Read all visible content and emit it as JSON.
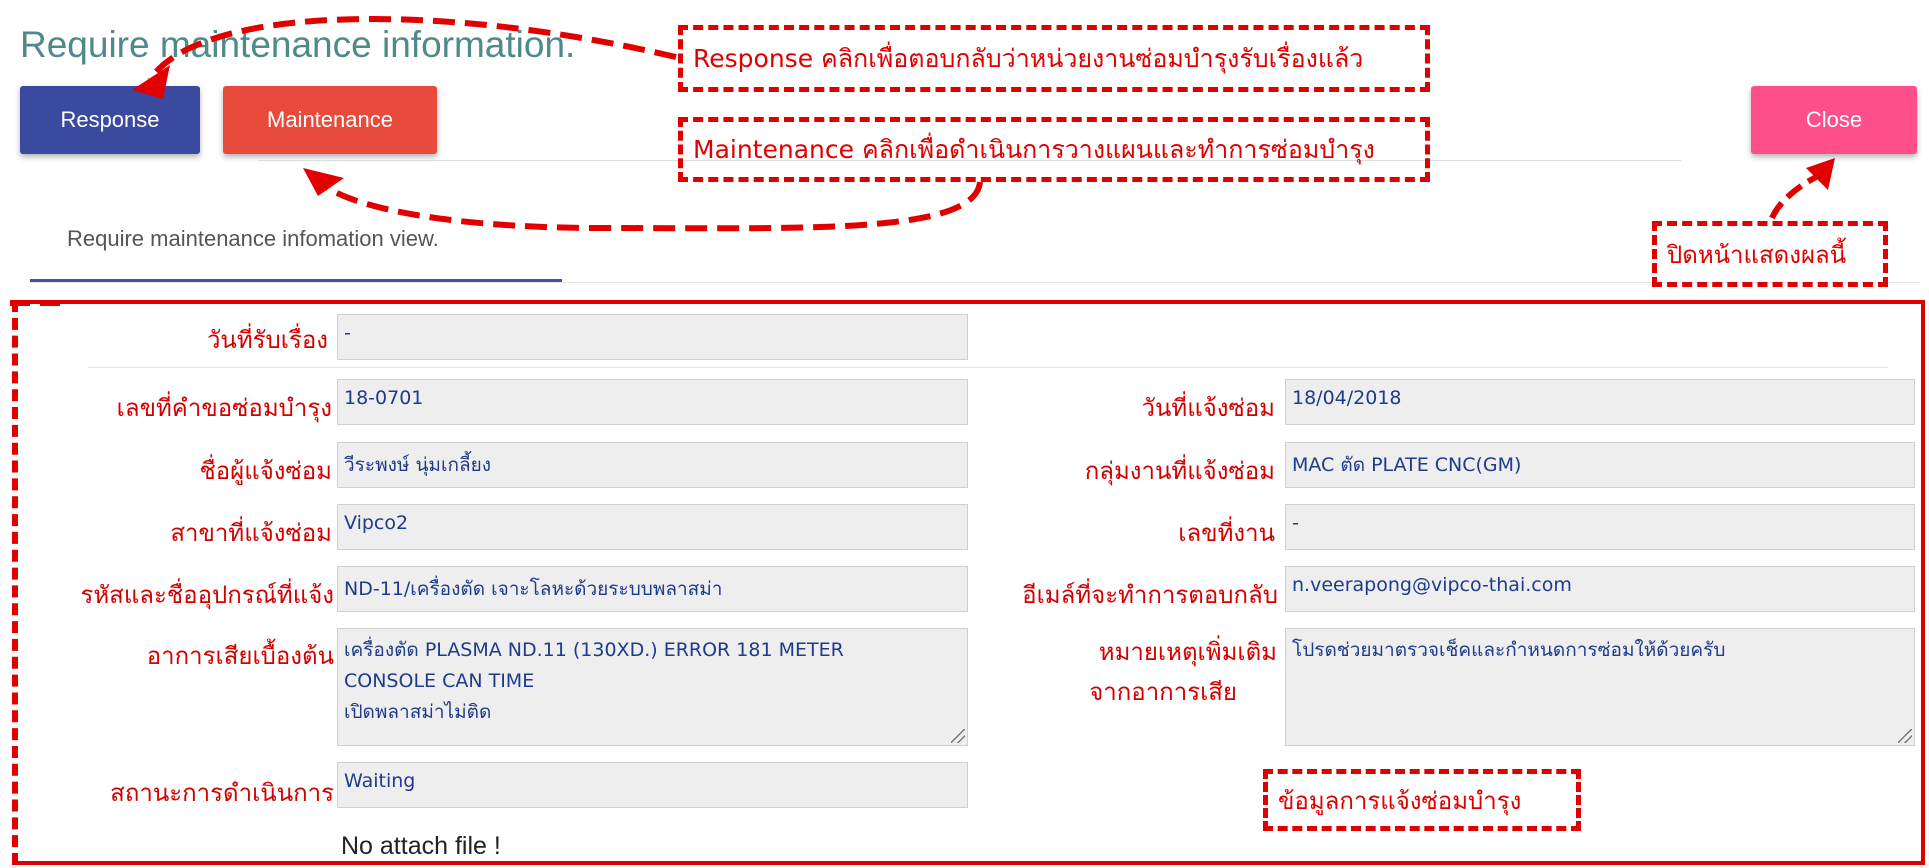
{
  "header": {
    "title": "Require maintenance information.",
    "tab_label": "Require maintenance infomation view."
  },
  "toolbar": {
    "response_label": "Response",
    "maintenance_label": "Maintenance",
    "close_label": "Close"
  },
  "callouts": {
    "response": "Response คลิกเพื่อตอบกลับว่าหน่วยงานซ่อมบำรุงรับเรื่องแล้ว",
    "maintenance": "Maintenance คลิกเพื่อดำเนินการวางแผนและทำการซ่อมบำรุง",
    "close": "ปิดหน้าแสดงผลนี้",
    "info": "ข้อมูลการแจ้งซ่อมบำรุง"
  },
  "form": {
    "received_date": {
      "label": "วันที่รับเรื่อง",
      "value": "-"
    },
    "request_no": {
      "label": "เลขที่คำขอซ่อมบำรุง",
      "value": "18-0701"
    },
    "request_date": {
      "label": "วันที่แจ้งซ่อม",
      "value": "18/04/2018"
    },
    "requester": {
      "label": "ชื่อผู้แจ้งซ่อม",
      "value": "วีระพงษ์ นุ่มเกลี้ยง"
    },
    "work_group": {
      "label": "กลุ่มงานที่แจ้งซ่อม",
      "value": "MAC ตัด PLATE CNC(GM)"
    },
    "branch": {
      "label": "สาขาที่แจ้งซ่อม",
      "value": "Vipco2"
    },
    "job_no": {
      "label": "เลขที่งาน",
      "value": "-"
    },
    "equipment": {
      "label": "รหัสและชื่ออุปกรณ์ที่แจ้ง",
      "value": "ND-11/เครื่องตัด เจาะโลหะด้วยระบบพลาสม่า"
    },
    "email": {
      "label": "อีเมล์ที่จะทำการตอบกลับ",
      "value": "n.veerapong@vipco-thai.com"
    },
    "symptom": {
      "label": "อาการเสียเบื้องต้น",
      "line1": "เครื่องตัด PLASMA ND.11 (130XD.) ERROR 181 METER",
      "line2": "CONSOLE CAN TIME",
      "line3": "เปิดพลาสม่าไม่ติด"
    },
    "remark": {
      "label_line1": "หมายเหตุเพิ่มเติม",
      "label_line2": "จากอาการเสีย",
      "value": "โปรดช่วยมาตรวจเช็คและกำหนดการซ่อมให้ด้วยครับ"
    },
    "status": {
      "label": "สถานะการดำเนินการ",
      "value": "Waiting"
    },
    "attach": "No attach file !"
  },
  "colors": {
    "annotation": "#e00000",
    "response_btn": "#3a4a9f",
    "maintenance_btn": "#e84b3c",
    "close_btn": "#ff4f8a",
    "title": "#4f8a8b"
  }
}
